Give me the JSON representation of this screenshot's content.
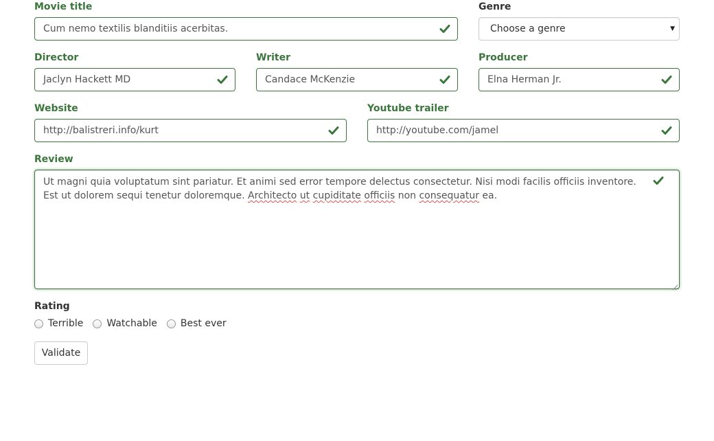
{
  "colors": {
    "success": "#3c763d",
    "label_neutral": "#333333",
    "input_text": "#555555",
    "spelling_underline": "#d9534f"
  },
  "fields": {
    "title": {
      "label": "Movie title",
      "value": "Cum nemo textilis blanditiis acerbitas.",
      "status_icon": "check-icon"
    },
    "genre": {
      "label": "Genre",
      "value": "Choose a genre",
      "caret_icon": "caret-down-icon"
    },
    "director": {
      "label": "Director",
      "value": "Jaclyn Hackett MD",
      "status_icon": "check-icon"
    },
    "writer": {
      "label": "Writer",
      "value": "Candace McKenzie",
      "status_icon": "check-icon"
    },
    "producer": {
      "label": "Producer",
      "value": "Elna Herman Jr.",
      "status_icon": "check-icon"
    },
    "website": {
      "label": "Website",
      "value": "http://balistreri.info/kurt",
      "status_icon": "check-icon"
    },
    "trailer": {
      "label": "Youtube trailer",
      "value": "http://youtube.com/jamel",
      "status_icon": "check-icon"
    },
    "review": {
      "label": "Review",
      "parts": [
        {
          "text": "Ut magni quia voluptatum sint pariatur. Et animi sed error tempore delectus consectetur. Nisi modi facilis officiis inventore. Est ut dolorem sequi tenetur doloremque. "
        },
        {
          "text": "Architecto",
          "misspelled": true
        },
        {
          "text": " "
        },
        {
          "text": "ut",
          "misspelled": true
        },
        {
          "text": " "
        },
        {
          "text": "cupiditate",
          "misspelled": true
        },
        {
          "text": " "
        },
        {
          "text": "officiis",
          "misspelled": true
        },
        {
          "text": " non "
        },
        {
          "text": "consequatur",
          "misspelled": true
        },
        {
          "text": " ea."
        }
      ],
      "status_icon": "check-icon"
    }
  },
  "rating": {
    "label": "Rating",
    "options": [
      "Terrible",
      "Watchable",
      "Best ever"
    ]
  },
  "actions": {
    "validate_label": "Validate"
  }
}
